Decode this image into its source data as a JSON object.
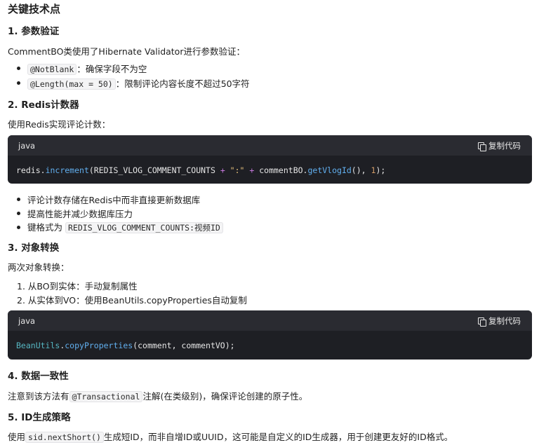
{
  "title": "关键技术点",
  "sections": [
    {
      "heading": "1. 参数验证",
      "intro": "CommentBO类使用了Hibernate Validator进行参数验证：",
      "bullets": [
        {
          "code": "@NotBlank",
          "text": "：确保字段不为空"
        },
        {
          "code": "@Length(max = 50)",
          "text": "：限制评论内容长度不超过50字符"
        }
      ]
    },
    {
      "heading": "2. Redis计数器",
      "intro": "使用Redis实现评论计数：",
      "code_block": {
        "lang": "java",
        "copy_label": "复制代码",
        "tokens": [
          {
            "t": "redis",
            "c": ""
          },
          {
            "t": ".",
            "c": ""
          },
          {
            "t": "increment",
            "c": "fn"
          },
          {
            "t": "(REDIS_VLOG_COMMENT_COUNTS ",
            "c": ""
          },
          {
            "t": "+",
            "c": "op"
          },
          {
            "t": " \":\" ",
            "c": "str"
          },
          {
            "t": "+",
            "c": "op"
          },
          {
            "t": " commentBO.",
            "c": ""
          },
          {
            "t": "getVlogId",
            "c": "fn"
          },
          {
            "t": "(), ",
            "c": ""
          },
          {
            "t": "1",
            "c": "num"
          },
          {
            "t": ");",
            "c": ""
          }
        ]
      },
      "bullets": [
        {
          "text": "评论计数存储在Redis中而非直接更新数据库"
        },
        {
          "text": "提高性能并减少数据库压力"
        },
        {
          "text": "键格式为",
          "code": "REDIS_VLOG_COMMENT_COUNTS:视频ID"
        }
      ]
    },
    {
      "heading": "3. 对象转换",
      "intro": "两次对象转换：",
      "numbered": [
        "1. 从BO到实体：手动复制属性",
        "2. 从实体到VO：使用BeanUtils.copyProperties自动复制"
      ],
      "code_block": {
        "lang": "java",
        "copy_label": "复制代码",
        "tokens": [
          {
            "t": "BeanUtils",
            "c": "cls"
          },
          {
            "t": ".",
            "c": ""
          },
          {
            "t": "copyProperties",
            "c": "fn"
          },
          {
            "t": "(comment, commentVO);",
            "c": ""
          }
        ]
      }
    },
    {
      "heading": "4. 数据一致性",
      "line": {
        "before": "注意到该方法有",
        "code": "@Transactional",
        "after": "注解(在类级别)，确保评论创建的原子性。"
      }
    },
    {
      "heading": "5. ID生成策略",
      "line": {
        "before": "使用",
        "code": "sid.nextShort()",
        "after": "生成短ID，而非自增ID或UUID，这可能是自定义的ID生成器，用于创建更友好的ID格式。"
      }
    }
  ],
  "colors": {
    "code_bg": "#1e1f24",
    "code_header": "#2a2b31",
    "inline_code_bg": "#f4f4f5"
  }
}
